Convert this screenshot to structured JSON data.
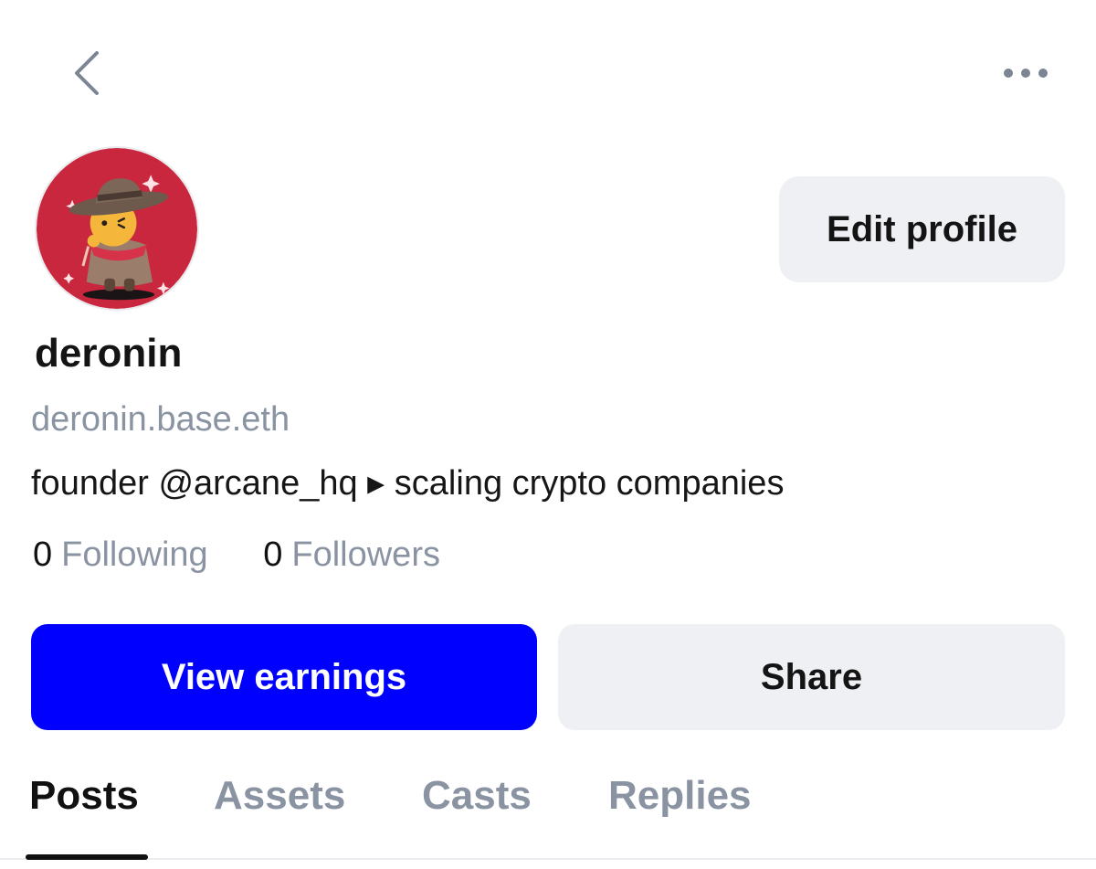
{
  "colors": {
    "accent": "#0000fe",
    "muted_text": "#8a93a2",
    "button_bg": "#eff0f4",
    "avatar_bg": "#c9273d"
  },
  "header": {
    "back_icon": "chevron-left-icon",
    "more_icon": "ellipsis-horizontal-icon"
  },
  "profile": {
    "avatar_icon": "cowboy-character-avatar",
    "edit_label": "Edit profile",
    "username": "deronin",
    "handle": "deronin.base.eth",
    "bio": "founder @arcane_hq ▸ scaling crypto companies",
    "stats": {
      "following_count": "0",
      "following_label": "Following",
      "followers_count": "0",
      "followers_label": "Followers"
    }
  },
  "actions": {
    "earnings_label": "View earnings",
    "share_label": "Share"
  },
  "tabs": [
    {
      "label": "Posts",
      "active": true
    },
    {
      "label": "Assets",
      "active": false
    },
    {
      "label": "Casts",
      "active": false
    },
    {
      "label": "Replies",
      "active": false
    }
  ]
}
